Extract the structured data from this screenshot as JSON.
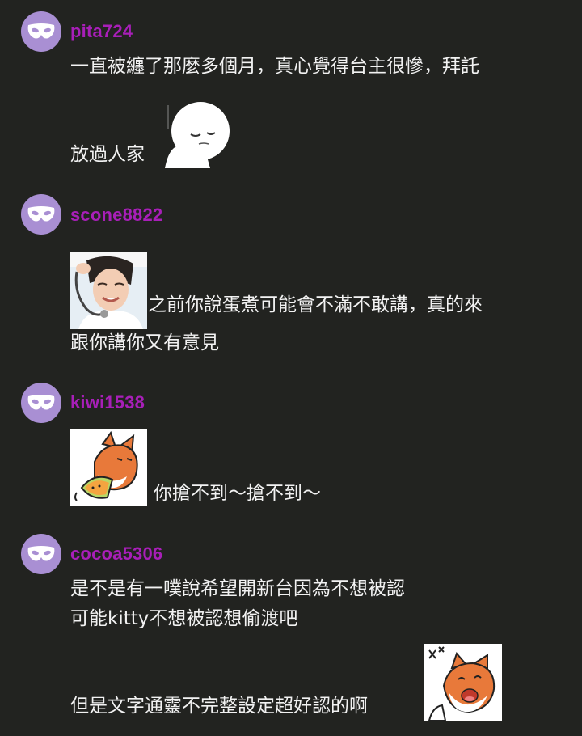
{
  "comments": [
    {
      "username": "pita724",
      "lines": [
        "一直被纏了那麼多個月，真心覺得台主很慘，拜託",
        "放過人家"
      ],
      "sticker": "sad-white-blob-sticker"
    },
    {
      "username": "scone8822",
      "lines": [
        "之前你說蛋煮可能會不滿不敢講，真的來",
        "跟你講你又有意見"
      ],
      "sticker": "nurse-photo-sticker"
    },
    {
      "username": "kiwi1538",
      "lines": [
        "你搶不到〜搶不到〜"
      ],
      "sticker": "fox-eating-melon-sticker"
    },
    {
      "username": "cocoa5306",
      "lines": [
        "是不是有一噗說希望開新台因為不想被認",
        "可能kitty不想被認想偷渡吧",
        "但是文字通靈不完整設定超好認的啊"
      ],
      "sticker": "laughing-fox-sticker"
    }
  ],
  "colors": {
    "background": "#222320",
    "username": "#a81fb8",
    "avatar": "#a98fd3",
    "text": "#f2f2f2"
  }
}
